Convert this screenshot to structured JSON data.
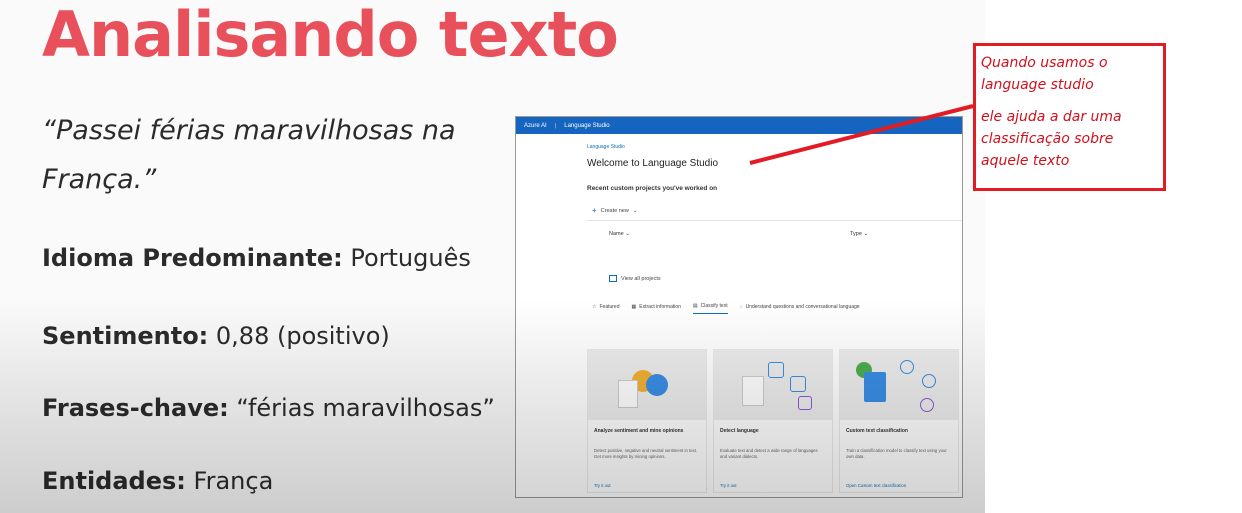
{
  "slide": {
    "title": "Analisando texto",
    "quote": "“Passei férias maravilhosas na França.”",
    "lines": [
      {
        "label": "Idioma Predominante:",
        "value": " Português"
      },
      {
        "label": "Sentimento:",
        "value": " 0,88 (positivo)"
      },
      {
        "label": "Frases-chave:",
        "value": " “férias maravilhosas”"
      },
      {
        "label": "Entidades:",
        "value": " França"
      }
    ]
  },
  "studio": {
    "topbar": {
      "product": "Azure AI",
      "separator": "|",
      "app": "Language Studio"
    },
    "breadcrumb": "Language Studio",
    "welcome": "Welcome to Language Studio",
    "recent_heading": "Recent custom projects you've worked on",
    "create_new": "Create new",
    "columns": {
      "name": "Name",
      "type": "Type"
    },
    "view_all": "View all projects",
    "tabs": [
      {
        "icon": "star-icon",
        "label": "Featured"
      },
      {
        "icon": "grid-icon",
        "label": "Extract information"
      },
      {
        "icon": "document-icon",
        "label": "Classify text"
      },
      {
        "icon": "chat-icon",
        "label": "Understand questions and conversational language"
      }
    ],
    "cards": [
      {
        "title": "Analyze sentiment and mine opinions",
        "desc": "Detect positive, negative and neutral sentiment in text. Get more insights by mining opinions.",
        "link": "Try it out"
      },
      {
        "title": "Detect language",
        "desc": "Evaluate text and detect a wide range of languages and variant dialects.",
        "link": "Try it out"
      },
      {
        "title": "Custom text classification",
        "desc": "Train a classification model to classify text using your own data.",
        "link": "Open Custom text classification"
      }
    ]
  },
  "annotation": {
    "line1": "Quando usamos o language studio",
    "line2": "ele ajuda a dar uma classificação sobre aquele texto",
    "color": "#e21b24"
  }
}
